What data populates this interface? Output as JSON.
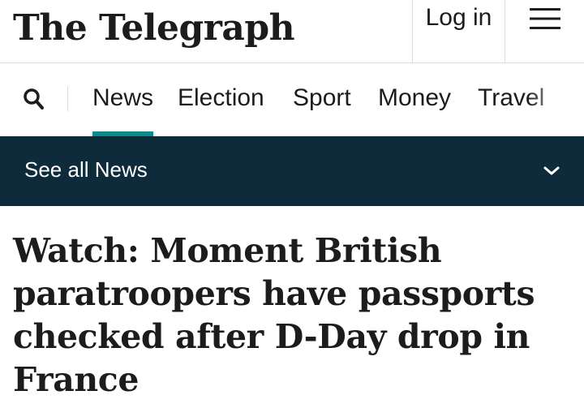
{
  "header": {
    "logo_text": "The Telegraph",
    "login_label": "Log in",
    "menu_icon": "hamburger-menu-icon"
  },
  "nav": {
    "search_icon": "search-icon",
    "items": [
      {
        "label": "News",
        "active": true
      },
      {
        "label": "Election",
        "active": false
      },
      {
        "label": "Sport",
        "active": false
      },
      {
        "label": "Money",
        "active": false
      },
      {
        "label": "Travel",
        "active": false
      }
    ]
  },
  "section_bar": {
    "label": "See all News",
    "chevron_icon": "chevron-down-icon"
  },
  "article": {
    "headline": "Watch: Moment British paratroopers have passports checked after D-Day drop in France"
  },
  "colors": {
    "section_bar_bg": "#0d2b3a",
    "active_underline": "#0d8a8a",
    "text": "#1c1c1c"
  }
}
